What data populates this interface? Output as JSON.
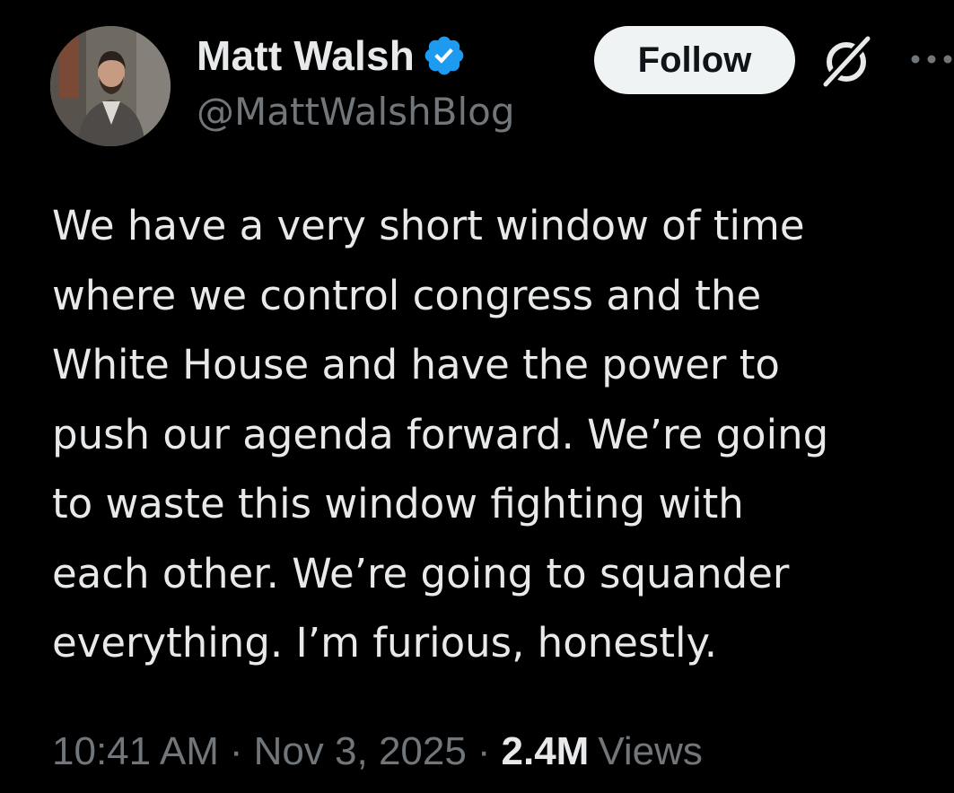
{
  "author": {
    "display_name": "Matt Walsh",
    "handle": "@MattWalshBlog",
    "verified_icon": "verified-badge-icon"
  },
  "actions": {
    "follow_label": "Follow",
    "grok_icon": "grok-icon",
    "more_icon": "more-options-icon"
  },
  "tweet": {
    "lines": [
      "We have a very short window of time",
      "where we control congress and the",
      "White House and have the power to",
      "push our agenda forward. We’re going",
      "to waste this window fighting with",
      "each other. We’re going to squander",
      "everything. I’m furious, honestly."
    ]
  },
  "meta": {
    "time": "10:41 AM",
    "separator": "·",
    "date": "Nov 3, 2025",
    "views_count": "2.4M",
    "views_label": "Views"
  },
  "colors": {
    "background": "#000000",
    "primary_text": "#e7e9ea",
    "secondary_text": "#71767b",
    "verified_blue": "#1d9bf0",
    "follow_button_bg": "#eff3f4"
  }
}
